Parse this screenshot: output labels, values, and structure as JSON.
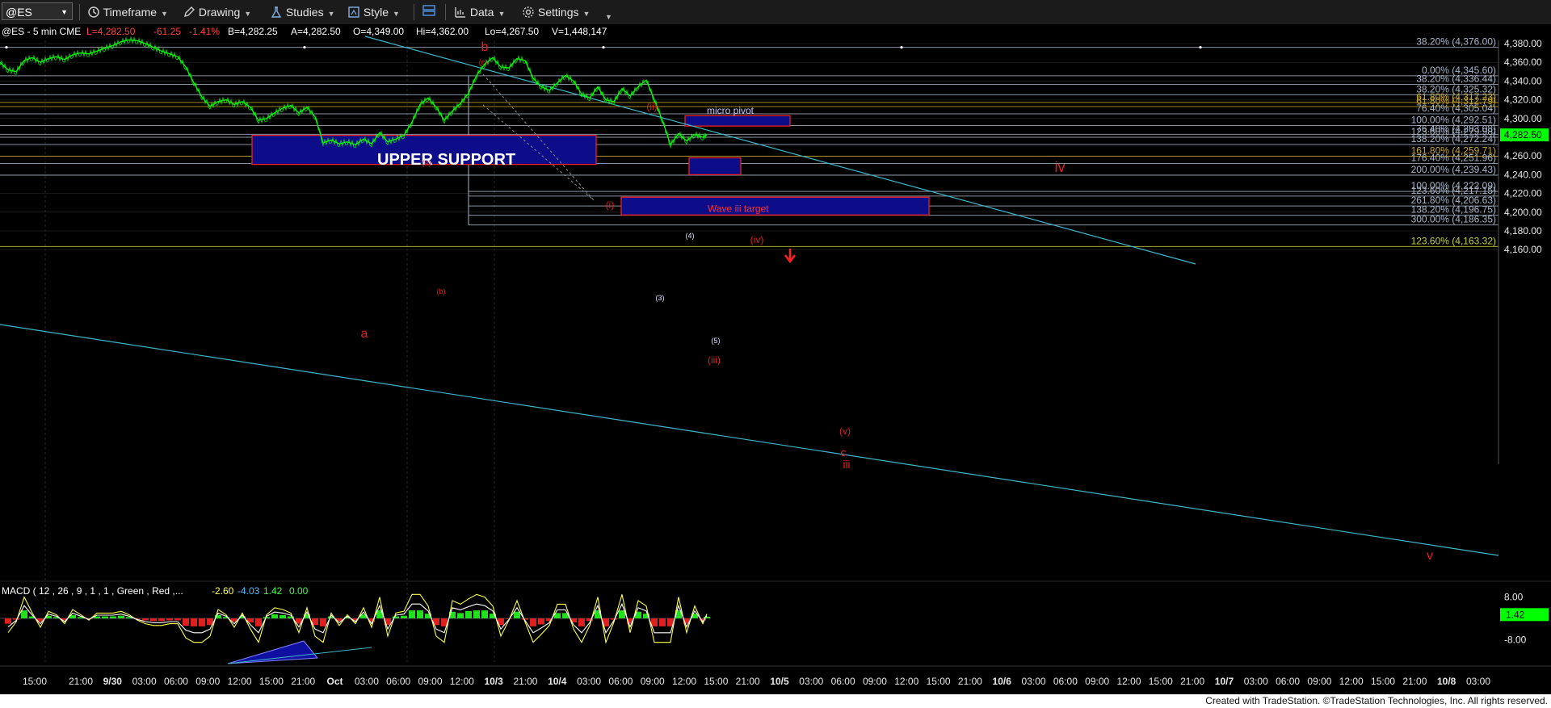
{
  "toolbar": {
    "symbol": "@ES",
    "timeframe": "Timeframe",
    "drawing": "Drawing",
    "studies": "Studies",
    "style": "Style",
    "data": "Data",
    "settings": "Settings"
  },
  "header": {
    "symbol_line": "@ES - 5 min  CME",
    "last": "L=4,282.50",
    "change": "-61.25",
    "change_pct": "-1.41%",
    "bid": "B=4,282.25",
    "ask": "A=4,282.50",
    "open": "O=4,349.00",
    "high": "Hi=4,362.00",
    "low": "Lo=4,267.50",
    "volume": "V=1,448,147"
  },
  "footer": "Created with TradeStation. ©TradeStation Technologies, Inc. All rights reserved.",
  "colors": {
    "background": "#000000",
    "price": "#00ff00",
    "trendline": "#3fb7c9",
    "fib_gray": "#aab6c8",
    "fib_gold": "#c8aa2a",
    "fib_green": "#c8d23a",
    "box_fill": "#0d0d8a",
    "box_border": "#ff2020",
    "label_red": "#e02020",
    "price_tag": "#00ff00"
  },
  "chart_data": {
    "type": "line",
    "price_axis": {
      "ticks": [
        "4,380.00",
        "4,360.00",
        "4,340.00",
        "4,320.00",
        "4,300.00",
        "4,280.00",
        "4,260.00",
        "4,240.00",
        "4,220.00",
        "4,200.00",
        "4,180.00",
        "4,160.00"
      ],
      "tick_values": [
        4380,
        4360,
        4340,
        4320,
        4300,
        4280,
        4260,
        4240,
        4220,
        4200,
        4180,
        4160
      ],
      "ylim": [
        4140,
        4386
      ],
      "last_price_tag": "4,282.50",
      "last_price": 4282.5
    },
    "time_axis": {
      "ticks": [
        "15:00",
        "21:00",
        "9/30",
        "03:00",
        "06:00",
        "09:00",
        "12:00",
        "15:00",
        "21:00",
        "Oct",
        "03:00",
        "06:00",
        "09:00",
        "12:00",
        "10/3",
        "21:00",
        "10/4",
        "03:00",
        "06:00",
        "09:00",
        "12:00",
        "15:00",
        "21:00",
        "10/5",
        "03:00",
        "06:00",
        "09:00",
        "12:00",
        "15:00",
        "21:00",
        "10/6",
        "03:00",
        "06:00",
        "09:00",
        "12:00",
        "15:00",
        "21:00",
        "10/7",
        "03:00",
        "06:00",
        "09:00",
        "12:00",
        "15:00",
        "21:00",
        "10/8",
        "03:00"
      ],
      "bold_ticks": [
        "9/30",
        "Oct",
        "10/3",
        "10/4",
        "10/5",
        "10/6",
        "10/7",
        "10/8"
      ]
    },
    "price_series": {
      "name": "@ES",
      "points": [
        [
          0,
          4360
        ],
        [
          10,
          4352
        ],
        [
          20,
          4350
        ],
        [
          30,
          4362
        ],
        [
          40,
          4365
        ],
        [
          50,
          4360
        ],
        [
          60,
          4364
        ],
        [
          70,
          4366
        ],
        [
          80,
          4363
        ],
        [
          90,
          4368
        ],
        [
          100,
          4370
        ],
        [
          110,
          4369
        ],
        [
          120,
          4372
        ],
        [
          130,
          4375
        ],
        [
          140,
          4378
        ],
        [
          150,
          4382
        ],
        [
          160,
          4384
        ],
        [
          170,
          4383
        ],
        [
          180,
          4380
        ],
        [
          190,
          4376
        ],
        [
          200,
          4372
        ],
        [
          210,
          4369
        ],
        [
          220,
          4366
        ],
        [
          230,
          4355
        ],
        [
          240,
          4338
        ],
        [
          250,
          4323
        ],
        [
          260,
          4313
        ],
        [
          270,
          4318
        ],
        [
          280,
          4320
        ],
        [
          290,
          4315
        ],
        [
          300,
          4318
        ],
        [
          310,
          4312
        ],
        [
          320,
          4298
        ],
        [
          330,
          4300
        ],
        [
          340,
          4306
        ],
        [
          350,
          4311
        ],
        [
          360,
          4314
        ],
        [
          370,
          4306
        ],
        [
          380,
          4312
        ],
        [
          390,
          4302
        ],
        [
          400,
          4274
        ],
        [
          410,
          4277
        ],
        [
          420,
          4273
        ],
        [
          430,
          4275
        ],
        [
          440,
          4272
        ],
        [
          450,
          4278
        ],
        [
          460,
          4273
        ],
        [
          470,
          4285
        ],
        [
          480,
          4275
        ],
        [
          490,
          4278
        ],
        [
          500,
          4282
        ],
        [
          510,
          4296
        ],
        [
          520,
          4315
        ],
        [
          530,
          4322
        ],
        [
          540,
          4312
        ],
        [
          550,
          4298
        ],
        [
          560,
          4308
        ],
        [
          570,
          4316
        ],
        [
          580,
          4327
        ],
        [
          590,
          4346
        ],
        [
          600,
          4358
        ],
        [
          610,
          4365
        ],
        [
          620,
          4355
        ],
        [
          630,
          4354
        ],
        [
          640,
          4364
        ],
        [
          650,
          4362
        ],
        [
          660,
          4343
        ],
        [
          670,
          4334
        ],
        [
          680,
          4330
        ],
        [
          690,
          4338
        ],
        [
          700,
          4346
        ],
        [
          710,
          4340
        ],
        [
          720,
          4326
        ],
        [
          730,
          4322
        ],
        [
          740,
          4334
        ],
        [
          750,
          4320
        ],
        [
          760,
          4318
        ],
        [
          770,
          4332
        ],
        [
          780,
          4324
        ],
        [
          790,
          4334
        ],
        [
          800,
          4341
        ],
        [
          810,
          4320
        ],
        [
          820,
          4298
        ],
        [
          830,
          4272
        ],
        [
          840,
          4284
        ],
        [
          850,
          4276
        ],
        [
          860,
          4283
        ],
        [
          870,
          4280
        ],
        [
          875,
          4282.5
        ]
      ]
    },
    "fib_levels": [
      {
        "label": "38.20% (4,376.00)",
        "value": 4376.0,
        "color": "gray"
      },
      {
        "label": "0.00% (4,345.60)",
        "value": 4345.6,
        "color": "gray"
      },
      {
        "label": "38.20% (4,336.44)",
        "value": 4336.44,
        "color": "gray"
      },
      {
        "label": "38.20% (4,325.32)",
        "value": 4325.32,
        "color": "gray"
      },
      {
        "label": "61.80% (4,317.23)",
        "value": 4317.23,
        "color": "gold"
      },
      {
        "label": "61.80% (4,312.79)",
        "value": 4312.79,
        "color": "gold"
      },
      {
        "label": "76.40% (4,305.04)",
        "value": 4305.04,
        "color": "gray"
      },
      {
        "label": "100.00% (4,292.51)",
        "value": 4292.51,
        "color": "gray"
      },
      {
        "label": "76.40% (4,283.08)",
        "value": 4283.08,
        "color": "gray"
      },
      {
        "label": "123.60% (4,279.98)",
        "value": 4279.98,
        "color": "gray"
      },
      {
        "label": "138.20% (4,272.24)",
        "value": 4272.24,
        "color": "gray"
      },
      {
        "label": "161.80% (4,259.71)",
        "value": 4259.71,
        "color": "gold"
      },
      {
        "label": "176.40% (4,251.96)",
        "value": 4251.96,
        "color": "gray"
      },
      {
        "label": "200.00% (4,239.43)",
        "value": 4239.43,
        "color": "gray"
      },
      {
        "label": "100.00% (4,222.09)",
        "value": 4222.09,
        "color": "gray"
      },
      {
        "label": "123.60% (4,217.15)",
        "value": 4217.15,
        "color": "gray"
      },
      {
        "label": "261.80% (4,206.63)",
        "value": 4206.63,
        "color": "gray"
      },
      {
        "label": "138.20% (4,196.75)",
        "value": 4196.75,
        "color": "gray"
      },
      {
        "label": "300.00% (4,186.35)",
        "value": 4186.35,
        "color": "gray"
      },
      {
        "label": "123.60% (4,163.32)",
        "value": 4163.32,
        "color": "green"
      }
    ],
    "boxes": [
      {
        "label": "UPPER SUPPORT",
        "price_top": 4282,
        "price_bottom": 4251
      },
      {
        "label": "micro pivot",
        "price_top": 4303,
        "price_bottom": 4292
      },
      {
        "label": "(iii)",
        "price_top": 4258,
        "price_bottom": 4240
      },
      {
        "label": "Wave iii target",
        "price_top": 4216,
        "price_bottom": 4197
      }
    ],
    "wave_labels": [
      "b",
      "a",
      "(c)",
      "(a)",
      "(b)",
      "(i)",
      "(ii)",
      "(iii)",
      "(iv)",
      "(v)",
      "(3)",
      "(4)",
      "(5)",
      "iii",
      "c",
      "iv",
      "v"
    ],
    "macd": {
      "title": "MACD ( 12 , 26 , 9 , 1 , 1 , Green , Red ,...",
      "values": [
        "-2.60",
        "-4.03",
        "1.42",
        "0.00"
      ],
      "axis_ticks": [
        "8.00",
        "-8.00"
      ],
      "tick_values": [
        8,
        -8
      ],
      "tag": "1.42"
    }
  }
}
